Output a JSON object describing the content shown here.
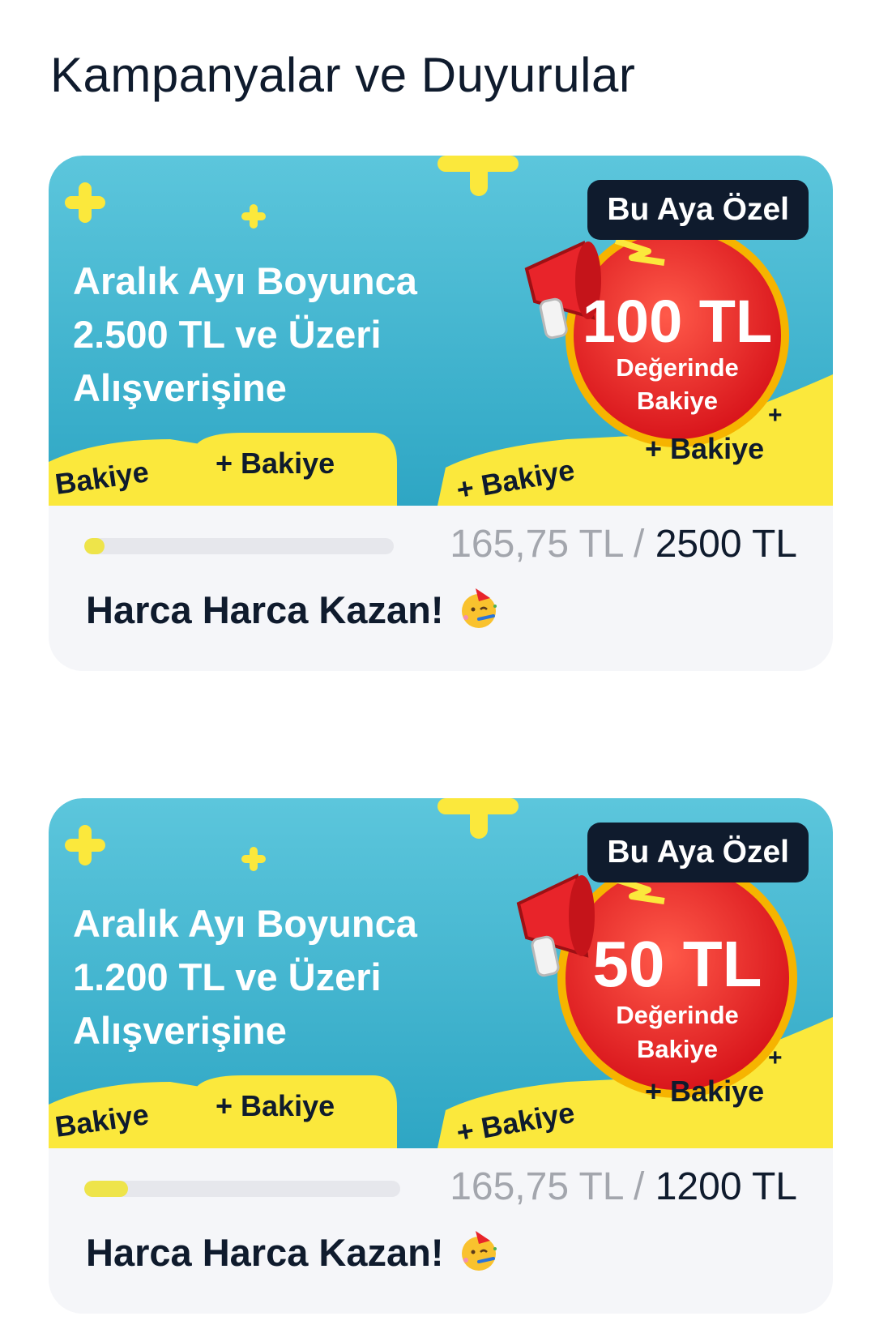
{
  "page": {
    "title": "Kampanyalar ve Duyurular"
  },
  "campaigns": [
    {
      "badge": "Bu Aya Özel",
      "headline_lines": [
        "Aralık Ayı Boyunca",
        "2.500 TL ve Üzeri",
        "Alışverişine"
      ],
      "reward_amount": "100 TL",
      "reward_line1": "Değerinde",
      "reward_line2": "Bakiye",
      "ribbon_text": "+ Bakiye",
      "ribbon_text_cut": "Bakiye",
      "progress_current": "165,75 TL",
      "progress_separator": " / ",
      "progress_target": "2500 TL",
      "progress_fraction": 0.066,
      "title": "Harca Harca Kazan!",
      "emoji": "party-face-icon"
    },
    {
      "badge": "Bu Aya Özel",
      "headline_lines": [
        "Aralık Ayı Boyunca",
        "1.200 TL ve Üzeri",
        "Alışverişine"
      ],
      "reward_amount": "50 TL",
      "reward_line1": "Değerinde",
      "reward_line2": "Bakiye",
      "ribbon_text": "+ Bakiye",
      "ribbon_text_cut": "Bakiye",
      "progress_current": "165,75 TL",
      "progress_separator": " / ",
      "progress_target": "1200 TL",
      "progress_fraction": 0.138,
      "title": "Harca Harca Kazan!",
      "emoji": "party-face-icon"
    }
  ],
  "colors": {
    "banner_bg": "#46b8d3",
    "accent_yellow": "#fbe83c",
    "reward_red": "#e8242a",
    "dark": "#0f1b2d",
    "muted": "#a3a6ad"
  }
}
